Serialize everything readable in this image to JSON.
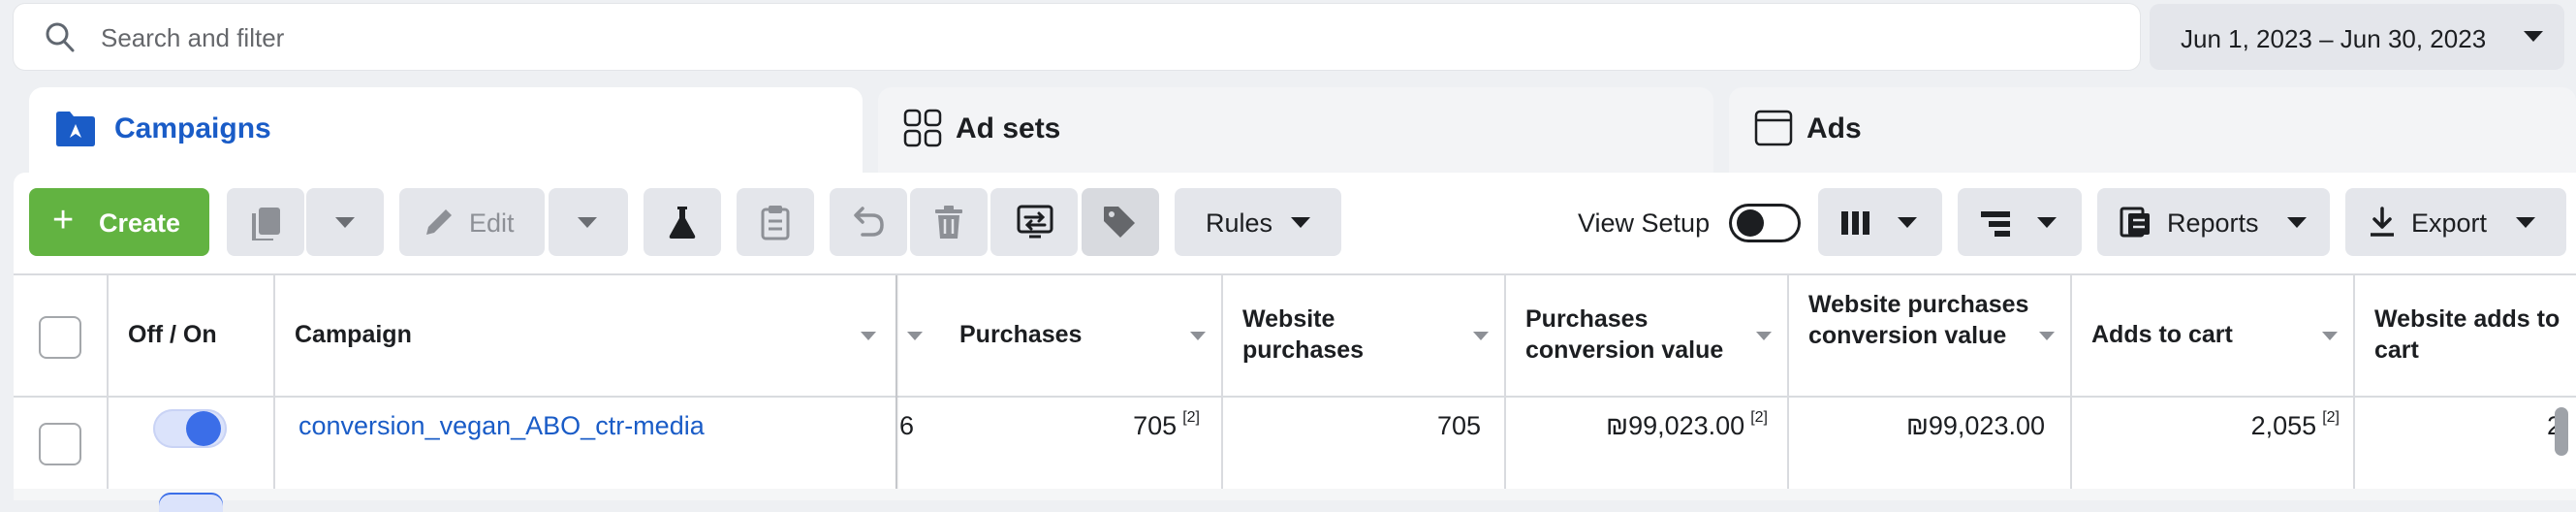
{
  "search": {
    "placeholder": "Search and filter"
  },
  "date_range": {
    "label": "Jun 1, 2023 – Jun 30, 2023"
  },
  "tabs": [
    {
      "label": "Campaigns",
      "active": true,
      "icon": "folder-icon"
    },
    {
      "label": "Ad sets",
      "active": false,
      "icon": "grid-icon"
    },
    {
      "label": "Ads",
      "active": false,
      "icon": "window-icon"
    }
  ],
  "toolbar": {
    "create_label": "Create",
    "edit_label": "Edit",
    "rules_label": "Rules",
    "view_setup_label": "View Setup",
    "view_setup_on": false,
    "reports_label": "Reports",
    "export_label": "Export"
  },
  "table": {
    "headers": {
      "off_on": "Off / On",
      "campaign": "Campaign",
      "purchases": "Purchases",
      "website_purchases": "Website purchases",
      "purchases_conversion_value": "Purchases conversion value",
      "website_purchases_conversion_value": "Website purchases conversion value",
      "adds_to_cart": "Adds to cart",
      "website_adds_to_cart": "Website adds to cart"
    },
    "rows": [
      {
        "campaign": "conversion_vegan_ABO_ctr-media",
        "enabled": true,
        "partial_value": "6",
        "purchases": "705",
        "purchases_note": "[2]",
        "website_purchases": "705",
        "purchases_conversion_value": "₪99,023.00",
        "purchases_conversion_value_note": "[2]",
        "website_purchases_conversion_value": "₪99,023.00",
        "adds_to_cart": "2,055",
        "adds_to_cart_note": "[2]",
        "website_adds_to_cart": "2"
      }
    ]
  },
  "colors": {
    "accent_blue": "#1a5cc7",
    "create_green": "#62b341",
    "toggle_blue": "#3b6ee8"
  }
}
